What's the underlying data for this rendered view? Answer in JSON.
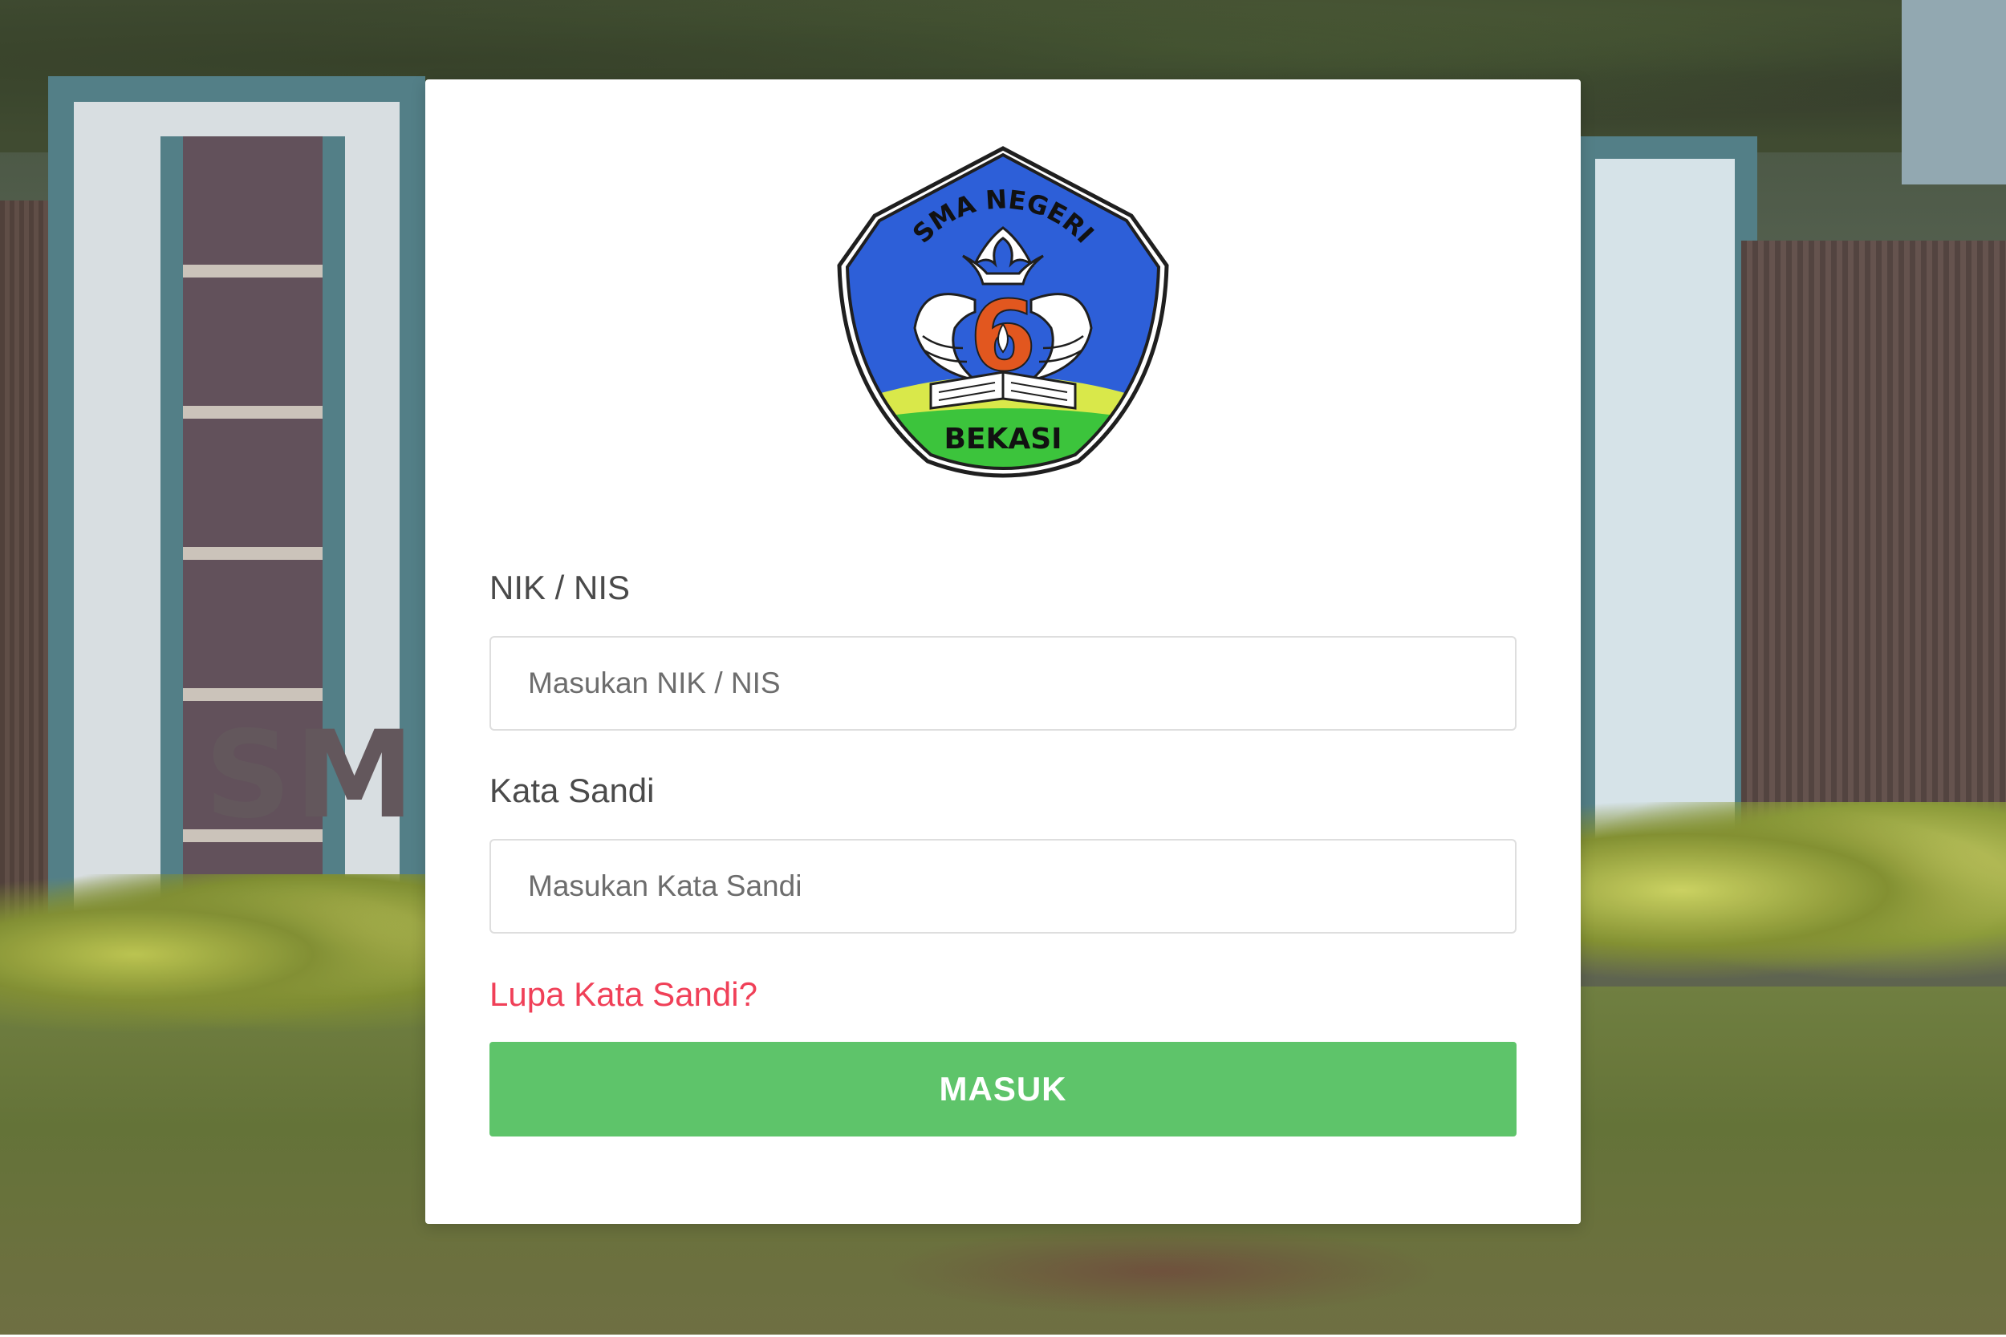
{
  "login": {
    "logo": {
      "top_text": "SMA NEGERI",
      "number": "6",
      "bottom_text": "BEKASI",
      "colors": {
        "shield_blue": "#2d5fd8",
        "hill_green": "#3cc43c",
        "hill_yellow": "#d9e84a",
        "number_orange": "#e2571f",
        "outline": "#1f1f1f"
      }
    },
    "nik_label": "NIK / NIS",
    "nik_placeholder": "Masukan NIK / NIS",
    "password_label": "Kata Sandi",
    "password_placeholder": "Masukan Kata Sandi",
    "forgot_link": "Lupa Kata Sandi?",
    "submit_label": "MASUK",
    "colors": {
      "submit_bg": "#5ec46a",
      "forgot_link": "#f04058",
      "label_text": "#4a4a4a"
    }
  }
}
